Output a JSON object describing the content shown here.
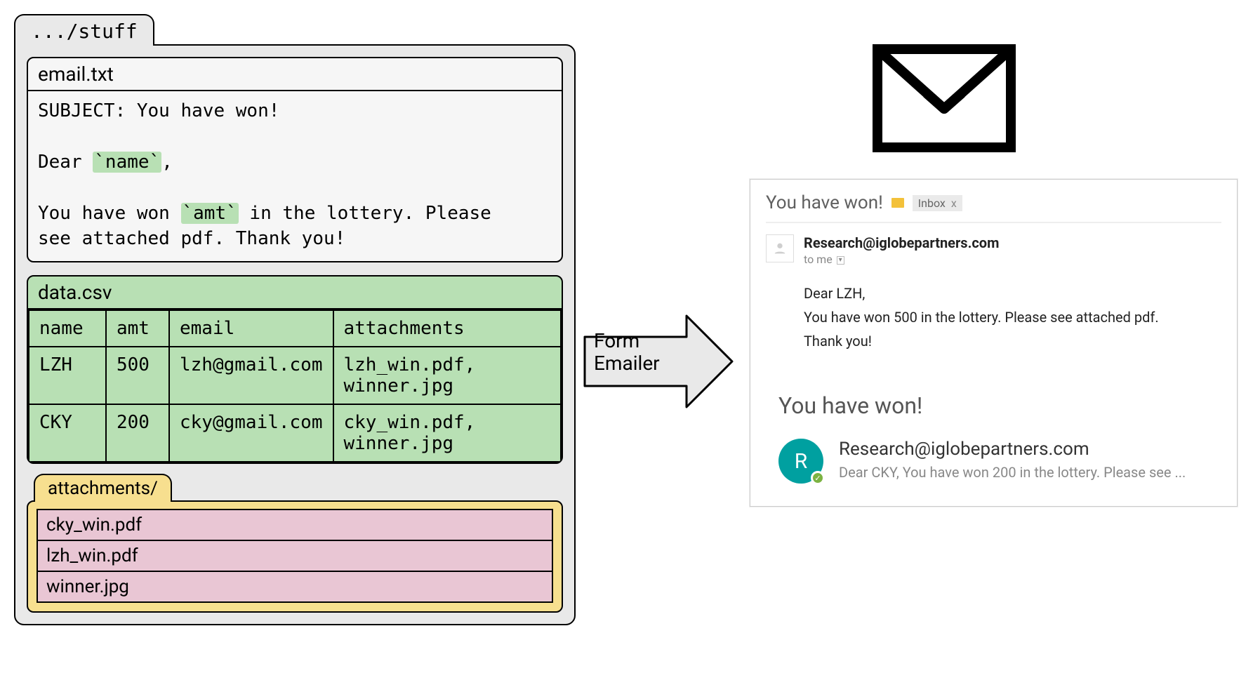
{
  "folder": {
    "tab": ".../stuff",
    "email_file": {
      "name": "email.txt",
      "subject_line": "SUBJECT: You have won!",
      "greeting_prefix": "Dear ",
      "greeting_var": "`name`",
      "greeting_suffix": ",",
      "body_prefix": "You have won ",
      "body_var": "`amt`",
      "body_suffix": " in the lottery. Please\nsee attached pdf. Thank you!"
    },
    "csv_file": {
      "name": "data.csv",
      "headers": [
        "name",
        "amt",
        "email",
        "attachments"
      ],
      "rows": [
        [
          "LZH",
          "500",
          "lzh@gmail.com",
          "lzh_win.pdf,\nwinner.jpg"
        ],
        [
          "CKY",
          "200",
          "cky@gmail.com",
          "cky_win.pdf,\nwinner.jpg"
        ]
      ]
    },
    "attachments": {
      "name": "attachments/",
      "files": [
        "cky_win.pdf",
        "lzh_win.pdf",
        "winner.jpg"
      ]
    }
  },
  "arrow_label": "Form\nEmailer",
  "inbox": {
    "subject": "You have won!",
    "badge_label": "Inbox",
    "badge_x": "x",
    "sender": "Research@iglobepartners.com",
    "to_line": "to me",
    "body_l1": "Dear LZH,",
    "body_l2": "You have won 500 in the lottery. Please see attached pdf.",
    "body_l3": "Thank you!"
  },
  "notif": {
    "subject": "You have won!",
    "avatar_letter": "R",
    "sender": "Research@iglobepartners.com",
    "preview": "Dear CKY, You have won 200 in the lottery. Please see ..."
  }
}
